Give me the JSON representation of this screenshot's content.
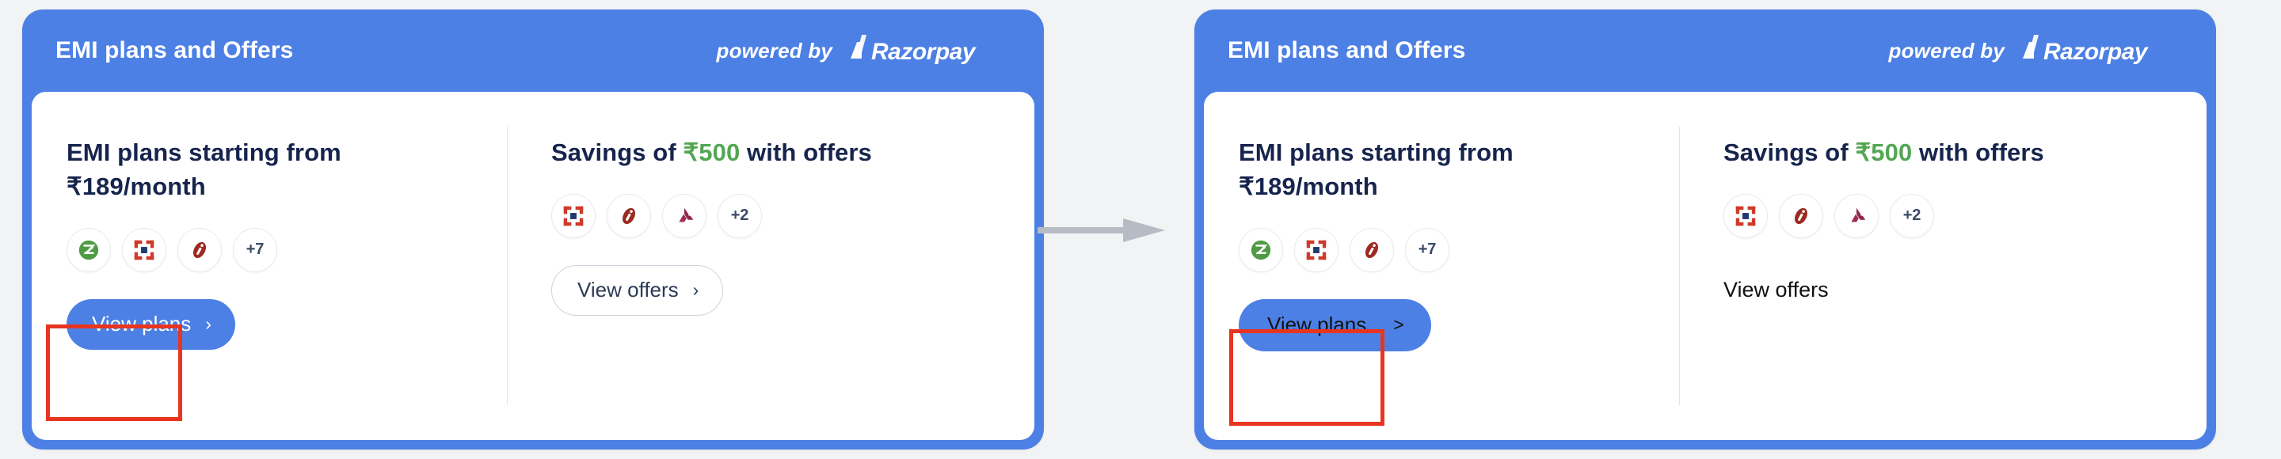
{
  "page": {
    "background_color": "#f2f3f5",
    "accent_blue": "#4d80e4",
    "heading_navy": "#16244d",
    "savings_green": "#53a653",
    "annotation_red": "#e8351f",
    "arrow_gray": "#b7bcc4"
  },
  "cards": [
    {
      "id": "before",
      "header": {
        "title": "EMI plans and Offers",
        "powered_by_label": "powered by",
        "brand_name": "Razorpay"
      },
      "columns": [
        {
          "id": "emi-plans",
          "heading_plain": "EMI plans starting from ₹189/month",
          "heading_line1": "EMI plans starting from",
          "heading_line2": "₹189/month",
          "chips": [
            {
              "name": "zestmoney-logo",
              "label": ""
            },
            {
              "name": "hdfc-bank-logo",
              "label": ""
            },
            {
              "name": "icici-bank-logo",
              "label": ""
            },
            {
              "name": "more-count",
              "label": "+7"
            }
          ],
          "action": {
            "label": "View plans",
            "chevron": "›",
            "style": "primary",
            "highlighted": true
          }
        },
        {
          "id": "offers",
          "heading_prefix": "Savings of ",
          "heading_amount": "₹500",
          "heading_suffix": " with offers",
          "chips": [
            {
              "name": "hdfc-bank-logo",
              "label": ""
            },
            {
              "name": "icici-bank-logo",
              "label": ""
            },
            {
              "name": "axis-bank-logo",
              "label": ""
            },
            {
              "name": "more-count",
              "label": "+2"
            }
          ],
          "action": {
            "label": "View offers",
            "chevron": "›",
            "style": "outline",
            "highlighted": false
          }
        }
      ]
    },
    {
      "id": "after",
      "header": {
        "title": "EMI plans and Offers",
        "powered_by_label": "powered by",
        "brand_name": "Razorpay"
      },
      "columns": [
        {
          "id": "emi-plans",
          "heading_plain": "EMI plans starting from ₹189/month",
          "heading_line1": "EMI plans starting from",
          "heading_line2": "₹189/month",
          "chips": [
            {
              "name": "zestmoney-logo",
              "label": ""
            },
            {
              "name": "hdfc-bank-logo",
              "label": ""
            },
            {
              "name": "icici-bank-logo",
              "label": ""
            },
            {
              "name": "more-count",
              "label": "+7"
            }
          ],
          "action": {
            "label": "View plans",
            "chevron": ">",
            "style": "primary",
            "highlighted": true
          }
        },
        {
          "id": "offers",
          "heading_prefix": "Savings of ",
          "heading_amount": "₹500",
          "heading_suffix": " with offers",
          "chips": [
            {
              "name": "hdfc-bank-logo",
              "label": ""
            },
            {
              "name": "icici-bank-logo",
              "label": ""
            },
            {
              "name": "axis-bank-logo",
              "label": ""
            },
            {
              "name": "more-count",
              "label": "+2"
            }
          ],
          "action": {
            "label": "View offers",
            "chevron": "",
            "style": "plain",
            "highlighted": false
          }
        }
      ]
    }
  ],
  "transition": {
    "arrow_name": "right-arrow-icon",
    "direction": "right"
  }
}
